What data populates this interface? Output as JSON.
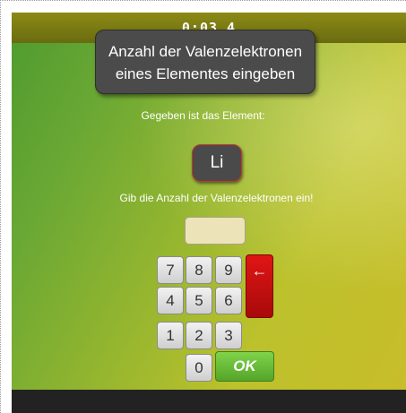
{
  "timer": "0:03.4",
  "prompt": {
    "line1": "Anzahl der Valenzelektronen",
    "line2": "eines Elementes eingeben"
  },
  "given_label": "Gegeben ist das Element:",
  "element_symbol": "Li",
  "instruction": "Gib die Anzahl der Valenzelektronen ein!",
  "answer_value": "",
  "keypad": {
    "k7": "7",
    "k8": "8",
    "k9": "9",
    "k4": "4",
    "k5": "5",
    "k6": "6",
    "k1": "1",
    "k2": "2",
    "k3": "3",
    "k0": "0",
    "backspace": "←",
    "ok": "OK"
  },
  "colors": {
    "backspace": "#c40f0f",
    "ok": "#6cc23a",
    "topbar": "#7b7a13"
  }
}
